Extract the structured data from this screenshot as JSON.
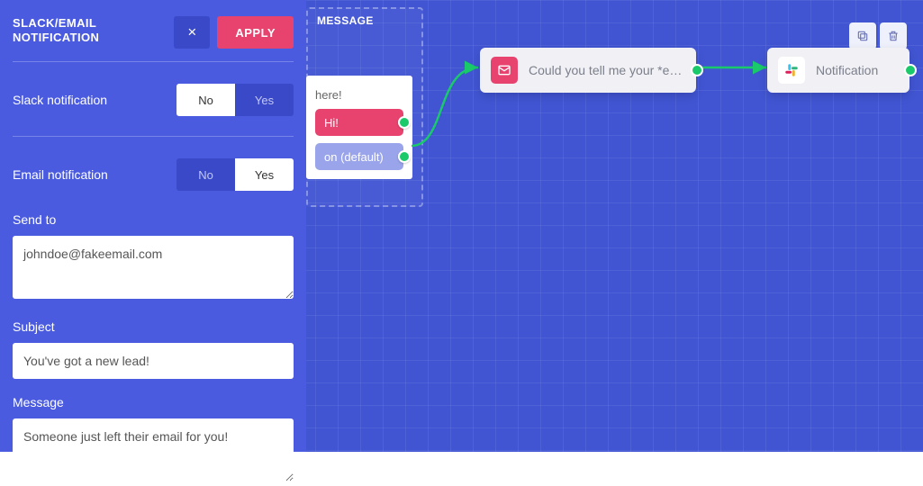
{
  "panel": {
    "title": "SLACK/EMAIL NOTIFICATION",
    "close": "×",
    "apply": "APPLY",
    "slack": {
      "label": "Slack notification",
      "no": "No",
      "yes": "Yes",
      "value": "No"
    },
    "email": {
      "label": "Email notification",
      "no": "No",
      "yes": "Yes",
      "value": "Yes"
    },
    "sendto": {
      "label": "Send to",
      "value": "johndoe@fakeemail.com"
    },
    "subject": {
      "label": "Subject",
      "value": "You've got a new lead!"
    },
    "message": {
      "label": "Message",
      "value": "Someone just left their email for you!"
    }
  },
  "canvas": {
    "msg_node": {
      "title": "MESSAGE",
      "greeting": "here!",
      "hi": "Hi!",
      "default": "on (default)"
    },
    "email_card": "Could you tell me your *e…",
    "notif_card": "Notification"
  },
  "colors": {
    "accent": "#e8426e",
    "bg": "#4155d3",
    "green": "#19c96a"
  }
}
